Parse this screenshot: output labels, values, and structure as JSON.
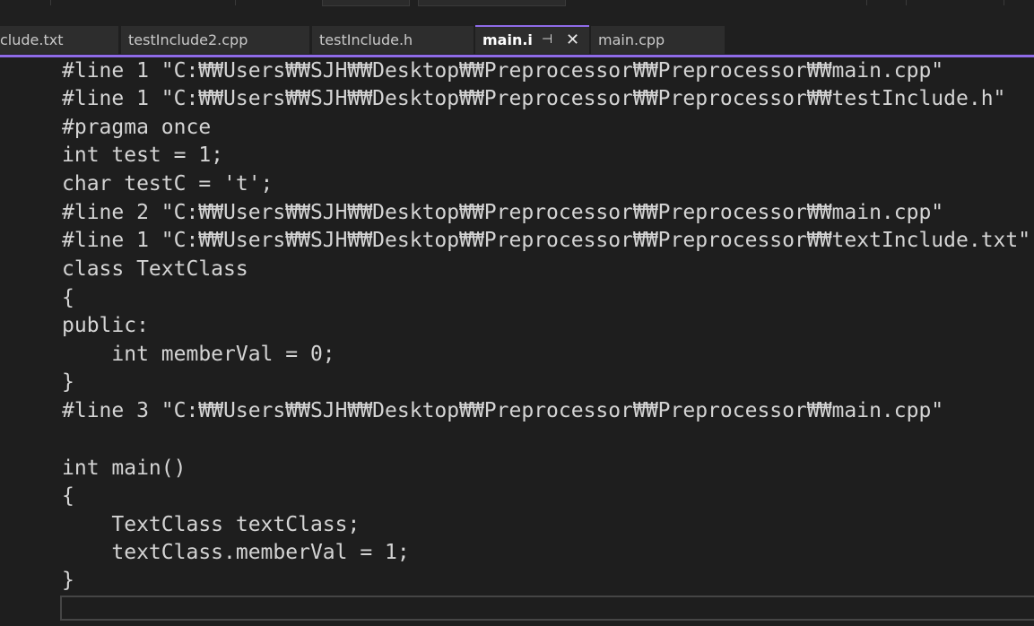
{
  "tabs": [
    {
      "label": "clude.txt"
    },
    {
      "label": "testInclude2.cpp"
    },
    {
      "label": "testInclude.h"
    },
    {
      "label": "main.i",
      "active": true
    },
    {
      "label": "main.cpp"
    }
  ],
  "active_tab_pin_glyph": "⊣",
  "active_tab_close_glyph": "✕",
  "accent_color": "#8f6be8",
  "editor": {
    "lines": [
      "#line 1 \"C:₩₩Users₩₩SJH₩₩Desktop₩₩Preprocessor₩₩Preprocessor₩₩main.cpp\"",
      "#line 1 \"C:₩₩Users₩₩SJH₩₩Desktop₩₩Preprocessor₩₩Preprocessor₩₩testInclude.h\"",
      "#pragma once",
      "int test = 1;",
      "char testC = 't';",
      "#line 2 \"C:₩₩Users₩₩SJH₩₩Desktop₩₩Preprocessor₩₩Preprocessor₩₩main.cpp\"",
      "#line 1 \"C:₩₩Users₩₩SJH₩₩Desktop₩₩Preprocessor₩₩Preprocessor₩₩textInclude.txt\"",
      "class TextClass",
      "{",
      "public:",
      "    int memberVal = 0;",
      "}",
      "#line 3 \"C:₩₩Users₩₩SJH₩₩Desktop₩₩Preprocessor₩₩Preprocessor₩₩main.cpp\"",
      "",
      "int main()",
      "{",
      "    TextClass textClass;",
      "    textClass.memberVal = 1;",
      "}"
    ]
  }
}
